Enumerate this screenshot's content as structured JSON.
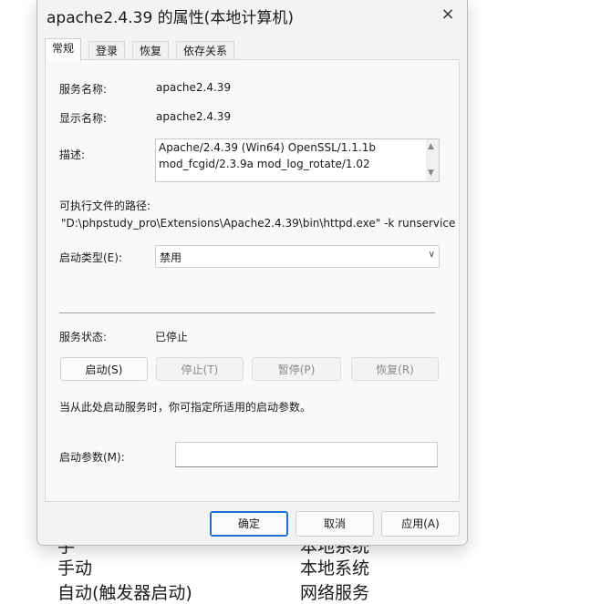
{
  "background": {
    "partial_top_left": "手",
    "partial_top_right": "本地系统",
    "row1_type": "手动",
    "row1_account": "本地系统",
    "row2_type": "自动(触发器启动)",
    "row2_account": "网络服务"
  },
  "dialog": {
    "title": "apache2.4.39 的属性(本地计算机)",
    "close_label": "×",
    "tabs": [
      "常规",
      "登录",
      "恢复",
      "依存关系"
    ],
    "service_name_label": "服务名称:",
    "service_name": "apache2.4.39",
    "display_name_label": "显示名称:",
    "display_name": "apache2.4.39",
    "description_label": "描述:",
    "description_line1": "Apache/2.4.39 (Win64) OpenSSL/1.1.1b",
    "description_line2": "mod_fcgid/2.3.9a mod_log_rotate/1.02",
    "exe_path_label": "可执行文件的路径:",
    "exe_path": "\"D:\\phpstudy_pro\\Extensions\\Apache2.4.39\\bin\\httpd.exe\" -k runservice",
    "startup_type_label": "启动类型(E):",
    "startup_type_value": "禁用",
    "service_status_label": "服务状态:",
    "service_status_value": "已停止",
    "buttons": {
      "start": "启动(S)",
      "stop": "停止(T)",
      "pause": "暂停(P)",
      "resume": "恢复(R)"
    },
    "hint": "当从此处启动服务时，你可指定所适用的启动参数。",
    "start_params_label": "启动参数(M):",
    "start_params_value": "",
    "footer": {
      "ok": "确定",
      "cancel": "取消",
      "apply": "应用(A)"
    }
  },
  "colors": {
    "primary_border": "#1d6fd0",
    "dialog_bg": "#f3f3f3"
  }
}
